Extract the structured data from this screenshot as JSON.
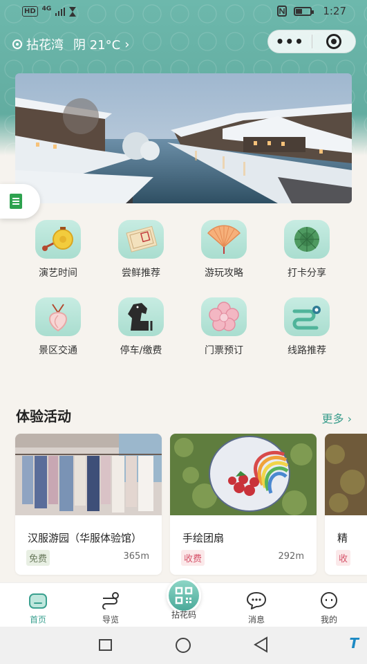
{
  "status_bar": {
    "left_tags": [
      "HD",
      "4G"
    ],
    "time": "1:27"
  },
  "header": {
    "location": "拈花湾",
    "weather": "阴 21°C",
    "chevron": "›",
    "capsule_more": "•••",
    "capsule_more_icon": "more-dots-icon",
    "capsule_close_icon": "target-close-icon"
  },
  "banner": {
    "description_icon": "snowy-canal-town-photo"
  },
  "floating_button": {
    "icon": "document-icon"
  },
  "menu": [
    {
      "label": "演艺时间",
      "icon": "gong-icon"
    },
    {
      "label": "尝鲜推荐",
      "icon": "scroll-ticket-icon"
    },
    {
      "label": "游玩攻略",
      "icon": "folding-fan-icon"
    },
    {
      "label": "打卡分享",
      "icon": "lotus-leaf-icon"
    },
    {
      "label": "景区交通",
      "icon": "peach-pendant-icon"
    },
    {
      "label": "停车/缴费",
      "icon": "horse-icon"
    },
    {
      "label": "门票预订",
      "icon": "flower-icon"
    },
    {
      "label": "线路推荐",
      "icon": "route-path-icon"
    }
  ],
  "section": {
    "title": "体验活动",
    "more": "更多",
    "more_chevron": "›"
  },
  "cards": [
    {
      "title": "汉服游园（华服体验馆）",
      "price": "免费",
      "distance": "365m"
    },
    {
      "title": "手绘团扇",
      "price": "收费",
      "distance": "292m"
    },
    {
      "title": "精",
      "price": "收",
      "distance": ""
    }
  ],
  "tabbar": {
    "tabs": [
      {
        "label": "首页",
        "icon": "home-icon",
        "active": true
      },
      {
        "label": "导览",
        "icon": "map-route-icon",
        "active": false
      },
      {
        "label": "拈花码",
        "icon": "qr-code-icon",
        "active": false
      },
      {
        "label": "消息",
        "icon": "chat-bubble-icon",
        "active": false
      },
      {
        "label": "我的",
        "icon": "profile-icon",
        "active": false
      }
    ]
  },
  "watermark": "T",
  "colors": {
    "teal": "#5ea89c",
    "accent": "#3aa08f",
    "free_text": "#6a7b5d",
    "paid_text": "#d6536a"
  }
}
